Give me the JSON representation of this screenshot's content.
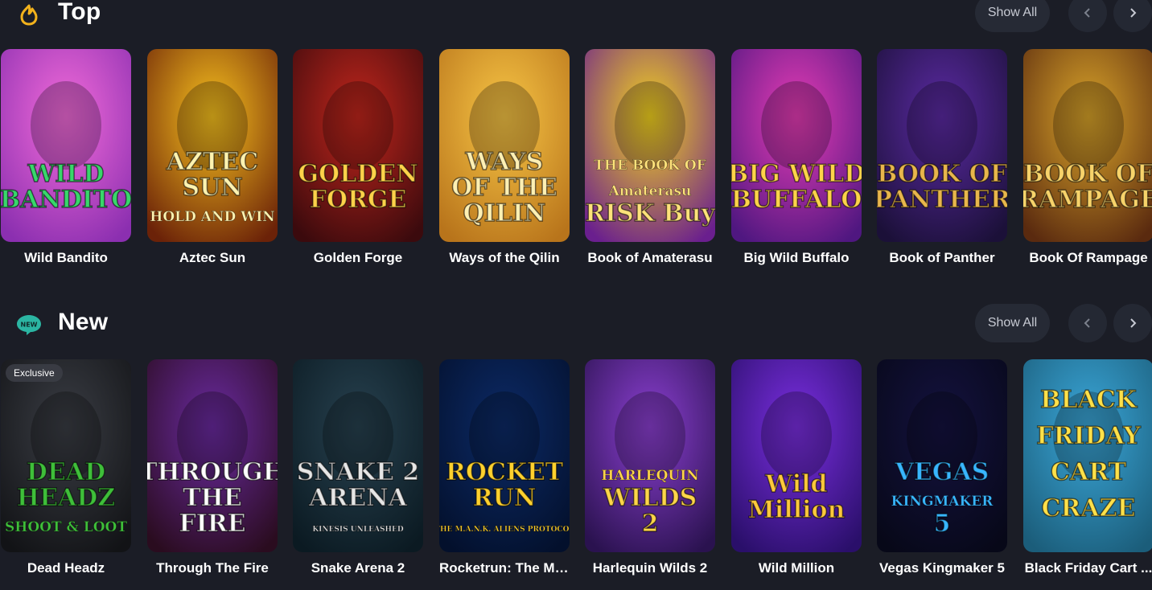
{
  "sections": {
    "top": {
      "title": "Top",
      "icon": "fire-icon",
      "show_all_label": "Show All",
      "prev_icon": "chevron-left-icon",
      "next_icon": "chevron-right-icon",
      "games": [
        {
          "label": "Wild Bandito",
          "art": [
            "WILD",
            "BANDITO"
          ],
          "colors": [
            "#f26bd9",
            "#8b2fb0",
            "#39d66b"
          ]
        },
        {
          "label": "Aztec Sun",
          "art": [
            "AZTEC",
            "SUN",
            "HOLD AND WIN"
          ],
          "colors": [
            "#f8c21e",
            "#6b2208",
            "#fff3b0"
          ]
        },
        {
          "label": "Golden Forge",
          "art": [
            "GOLDEN",
            "FORGE"
          ],
          "colors": [
            "#c2261c",
            "#3b0a0d",
            "#ffd24a"
          ]
        },
        {
          "label": "Ways of the Qilin",
          "art": [
            "WAYS",
            "OF THE",
            "QILIN"
          ],
          "colors": [
            "#f7c545",
            "#b8741b",
            "#fff0b3"
          ]
        },
        {
          "label": "Book of Amaterasu",
          "art": [
            "THE BOOK OF",
            "Amaterasu",
            "RISK Buy"
          ],
          "colors": [
            "#f4d41e",
            "#6a1f8e",
            "#ffe27a"
          ]
        },
        {
          "label": "Big Wild Buffalo",
          "art": [
            "BIG WILD",
            "BUFFALO"
          ],
          "colors": [
            "#e63cb5",
            "#4f1780",
            "#ffd34a"
          ]
        },
        {
          "label": "Book of Panther",
          "art": [
            "BOOK OF",
            "PANTHER"
          ],
          "colors": [
            "#5b2aa3",
            "#1b1038",
            "#e8b64c"
          ]
        },
        {
          "label": "Book Of Rampage",
          "art": [
            "BOOK OF",
            "RAMPAGE"
          ],
          "colors": [
            "#d9a42a",
            "#5a2a0f",
            "#f7d36a"
          ]
        }
      ]
    },
    "new": {
      "title": "New",
      "icon": "new-badge-icon",
      "icon_text": "NEW",
      "show_all_label": "Show All",
      "prev_icon": "chevron-left-icon",
      "next_icon": "chevron-right-icon",
      "games": [
        {
          "label": "Dead Headz",
          "badge": "Exclusive",
          "art": [
            "DEAD",
            "HEADZ",
            "SHOOT & LOOT"
          ],
          "colors": [
            "#3a3d44",
            "#121316",
            "#3fbf3a"
          ]
        },
        {
          "label": "Through The Fire",
          "art": [
            "THROUGH",
            "THE",
            "FIRE"
          ],
          "colors": [
            "#6a2aa0",
            "#2a0c1f",
            "#ffffff"
          ]
        },
        {
          "label": "Snake Arena 2",
          "art": [
            "SNAKE 2",
            "ARENA",
            "KINESIS UNLEASHED"
          ],
          "colors": [
            "#27414f",
            "#0b1a22",
            "#e6e6e6"
          ]
        },
        {
          "label": "Rocketrun: The M....",
          "art": [
            "ROCKET",
            "RUN",
            "THE M.A.N.K. ALIENS PROTOCOL"
          ],
          "colors": [
            "#0c2a66",
            "#03102c",
            "#ffd12e"
          ]
        },
        {
          "label": "Harlequin Wilds 2",
          "art": [
            "HARLEQUIN",
            "WILDS",
            "2"
          ],
          "colors": [
            "#8b3fd1",
            "#2a124f",
            "#ffd54a"
          ]
        },
        {
          "label": "Wild Million",
          "art": [
            "Wild",
            "Million"
          ],
          "colors": [
            "#7a2ee0",
            "#2a0f6a",
            "#ffc93c"
          ]
        },
        {
          "label": "Vegas Kingmaker 5",
          "art": [
            "VEGAS",
            "KINGMAKER",
            "5"
          ],
          "colors": [
            "#14123f",
            "#070818",
            "#38b6ff"
          ]
        },
        {
          "label": "Black Friday Cart ...",
          "art": [
            "BLACK",
            "FRIDAY",
            "CART",
            "CRAZE"
          ],
          "colors": [
            "#3aa6d8",
            "#1b5d7a",
            "#ffe14a"
          ]
        }
      ]
    }
  }
}
